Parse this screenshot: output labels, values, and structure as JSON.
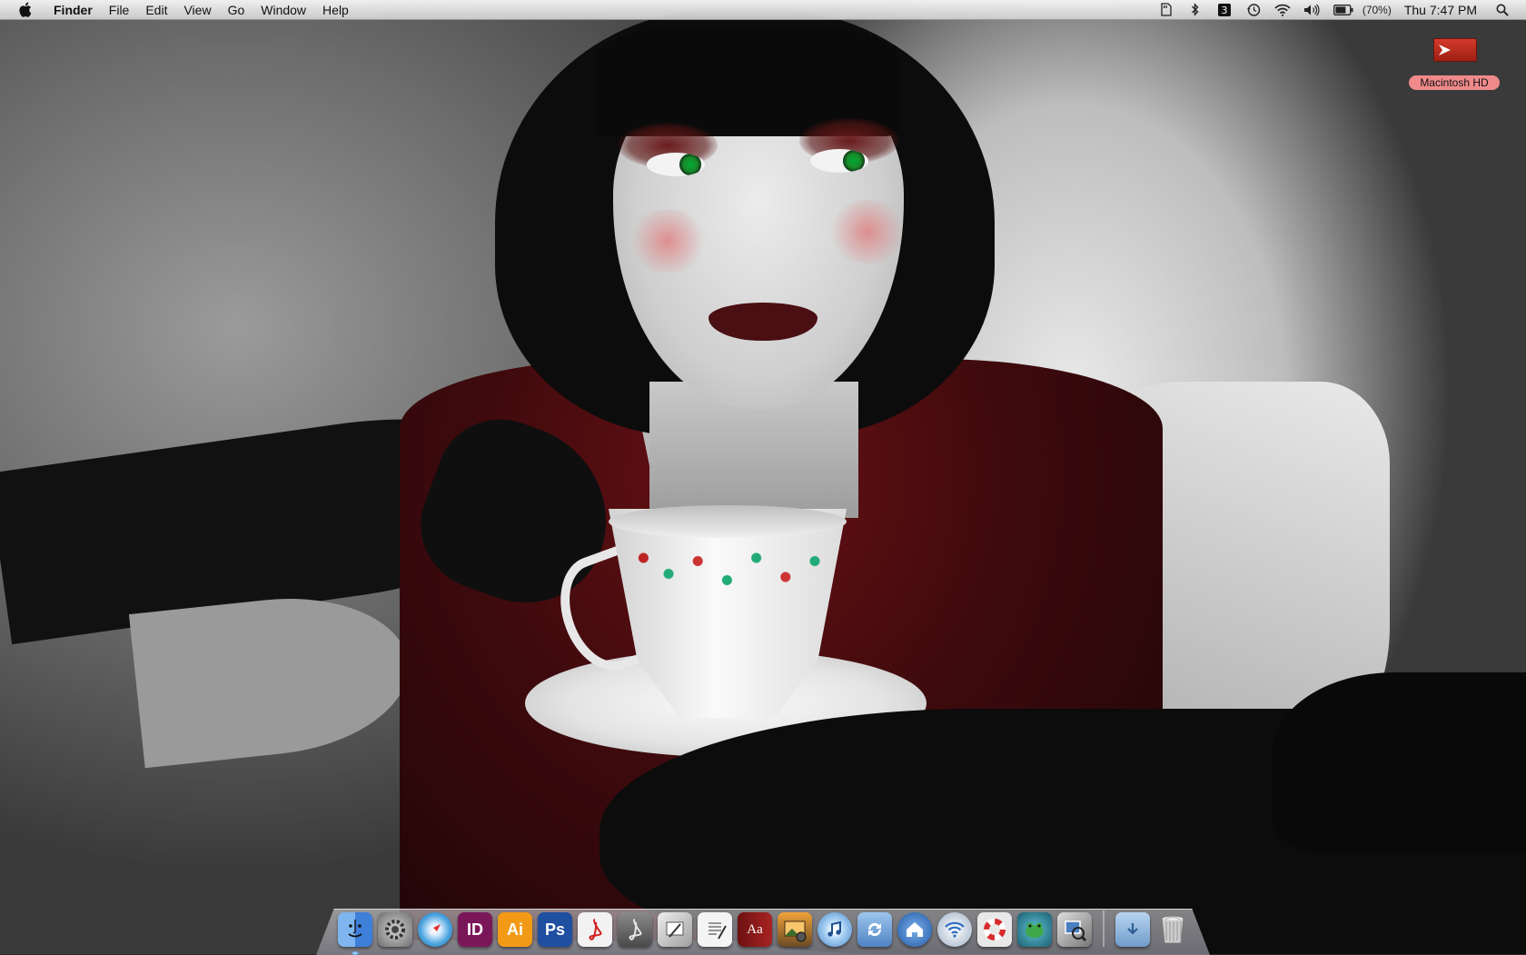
{
  "menubar": {
    "app_name": "Finder",
    "menus": [
      "File",
      "Edit",
      "View",
      "Go",
      "Window",
      "Help"
    ],
    "battery_percent": "(70%)",
    "clock": "Thu 7:47 PM",
    "status_icons": [
      "sdcard-icon",
      "bluetooth-icon",
      "app-status-icon",
      "time-machine-icon",
      "wifi-icon",
      "volume-icon",
      "battery-icon",
      "spotlight-icon"
    ]
  },
  "desktop": {
    "drive_label": "Macintosh HD"
  },
  "dock": {
    "items": [
      {
        "icon": "finder-icon",
        "color": "#3d7fd9"
      },
      {
        "icon": "system-preferences-icon",
        "color": "#8a8a8a"
      },
      {
        "icon": "safari-icon",
        "color": "#4aa3df"
      },
      {
        "icon": "indesign-icon",
        "color": "#7a1759",
        "glyph": "ID"
      },
      {
        "icon": "illustrator-icon",
        "color": "#f29a16",
        "glyph": "Ai"
      },
      {
        "icon": "photoshop-icon",
        "color": "#1e4fa0",
        "glyph": "Ps"
      },
      {
        "icon": "acrobat-icon",
        "color": "#f2f2f2"
      },
      {
        "icon": "acrobat-distiller-icon",
        "color": "#6b6b6b"
      },
      {
        "icon": "preview-icon",
        "color": "#bfbfbf"
      },
      {
        "icon": "textedit-icon",
        "color": "#e8e8e8"
      },
      {
        "icon": "dictionary-icon",
        "color": "#9b1c1c",
        "glyph": "Aa"
      },
      {
        "icon": "iphoto-icon",
        "color": "#8a6a3a"
      },
      {
        "icon": "itunes-icon",
        "color": "#7fb3e6"
      },
      {
        "icon": "software-update-icon",
        "color": "#5a9ae0"
      },
      {
        "icon": "home-network-icon",
        "color": "#2f6fc0"
      },
      {
        "icon": "airport-utility-icon",
        "color": "#cfd8e3"
      },
      {
        "icon": "help-lifebuoy-icon",
        "color": "#d9d9d9"
      },
      {
        "icon": "game-frog-icon",
        "color": "#2e8a9e"
      },
      {
        "icon": "preview-photos-icon",
        "color": "#9a9a9a"
      }
    ],
    "stack_items": [
      {
        "icon": "downloads-folder-icon",
        "color": "#8fb7dc"
      },
      {
        "icon": "trash-icon",
        "color": "#c9c9c9"
      }
    ]
  }
}
